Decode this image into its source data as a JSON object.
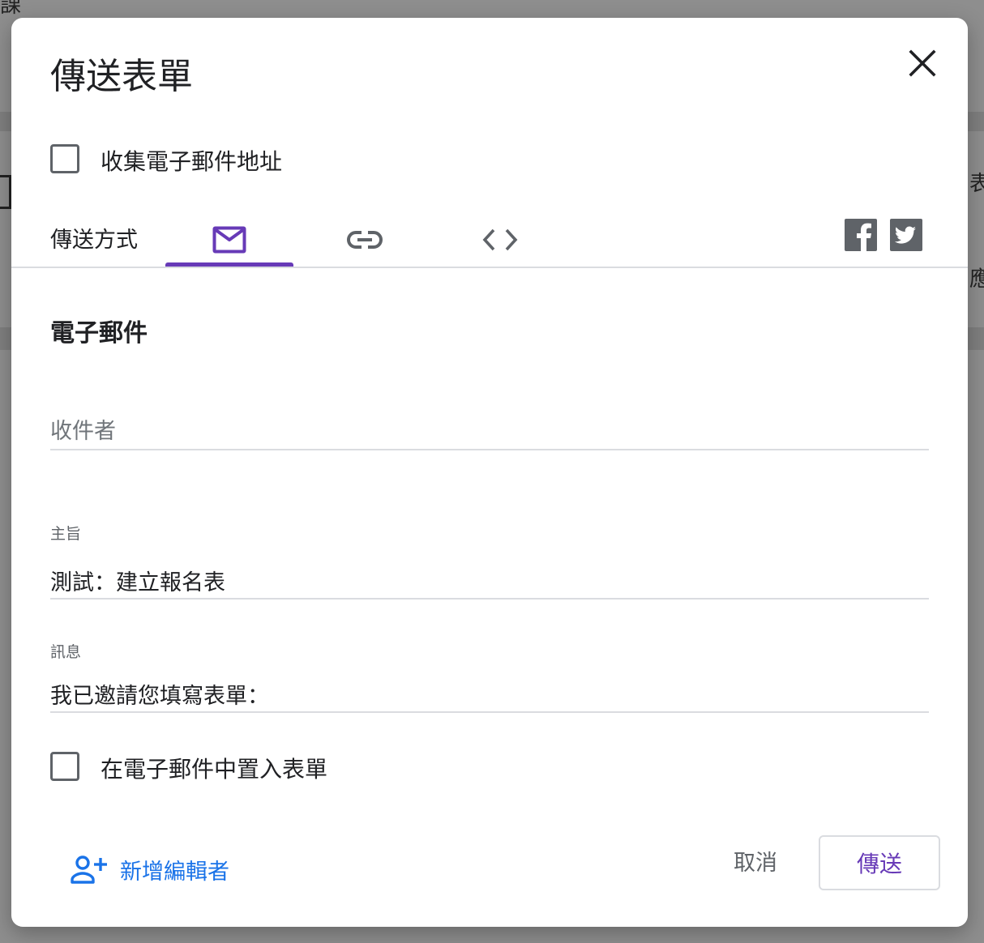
{
  "background": {
    "fragment_top_left": "課",
    "fragment_right_1": "表",
    "fragment_right_2": "應"
  },
  "dialog": {
    "title": "傳送表單",
    "collect_email": {
      "label": "收集電子郵件地址",
      "checked": false
    },
    "send_via_label": "傳送方式",
    "tabs": [
      {
        "icon": "email-icon",
        "active": true
      },
      {
        "icon": "link-icon",
        "active": false
      },
      {
        "icon": "embed-code-icon",
        "active": false
      }
    ],
    "share": {
      "facebook": "facebook-icon",
      "twitter": "twitter-icon"
    },
    "email_section": {
      "title": "電子郵件",
      "to": {
        "placeholder": "收件者",
        "value": ""
      },
      "subject": {
        "label": "主旨",
        "value": "測試：建立報名表"
      },
      "message": {
        "label": "訊息",
        "value": "我已邀請您填寫表單："
      },
      "include_form": {
        "label": "在電子郵件中置入表單",
        "checked": false
      }
    },
    "footer": {
      "add_editors": "新增編輯者",
      "cancel": "取消",
      "send": "傳送"
    }
  },
  "colors": {
    "accent": "#673ab7",
    "link": "#1a73e8",
    "text": "#202124",
    "secondary_text": "#5f6368",
    "divider": "#dadce0"
  }
}
